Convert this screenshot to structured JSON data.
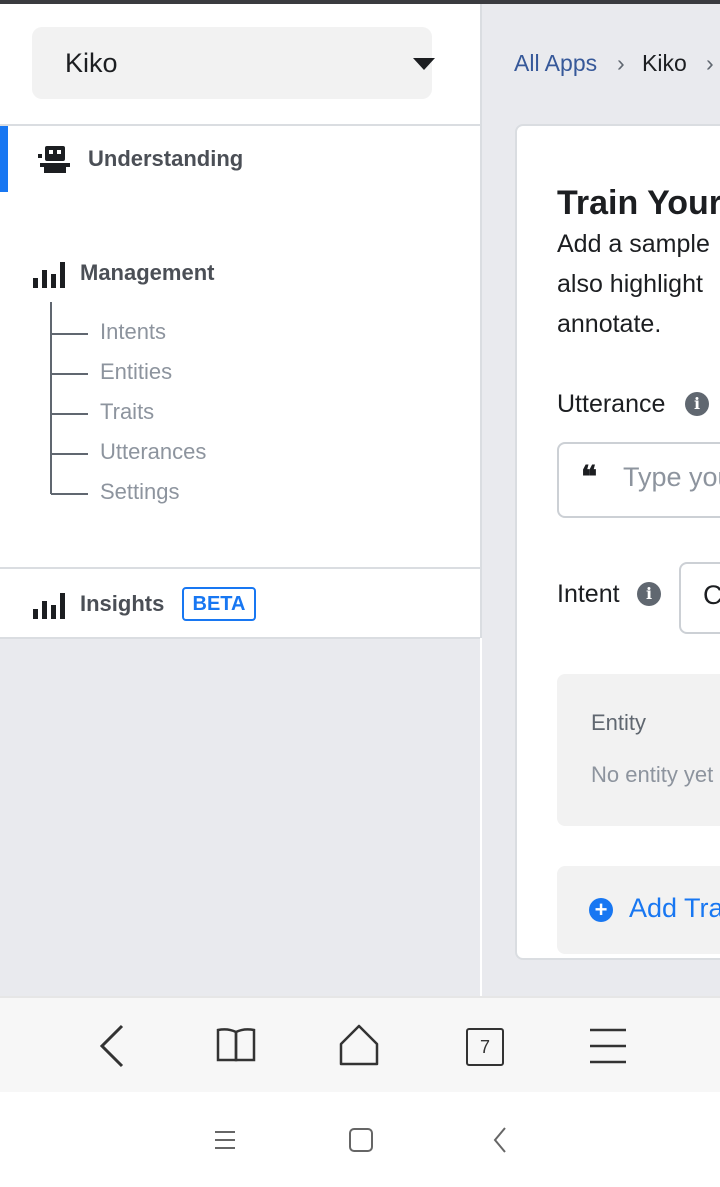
{
  "app_selector": {
    "selected": "Kiko",
    "icon": "caret-down-icon"
  },
  "sidebar": {
    "understanding": {
      "label": "Understanding",
      "icon": "robot-icon"
    },
    "management": {
      "label": "Management",
      "icon": "bar-chart-icon",
      "items": [
        {
          "label": "Intents"
        },
        {
          "label": "Entities"
        },
        {
          "label": "Traits"
        },
        {
          "label": "Utterances"
        },
        {
          "label": "Settings"
        }
      ]
    },
    "insights": {
      "label": "Insights",
      "badge": "BETA",
      "icon": "bar-chart-icon"
    }
  },
  "breadcrumb": {
    "root": "All Apps",
    "app": "Kiko",
    "sep1": "›",
    "sep2": "›"
  },
  "train_card": {
    "title": "Train Your",
    "description_lines": [
      "Add a sample",
      "also highlight",
      "annotate."
    ],
    "utterance_label": "Utterance",
    "utterance_placeholder": "Type you",
    "intent_label": "Intent",
    "intent_value": "C",
    "entity_title": "Entity",
    "entity_empty": "No entity yet",
    "add_trait_label": "Add Tra"
  },
  "browser_bar": {
    "tabs_count": "7"
  },
  "colors": {
    "accent": "#1877f2",
    "link": "#365899",
    "sidebar_bg": "#e9eaee"
  }
}
